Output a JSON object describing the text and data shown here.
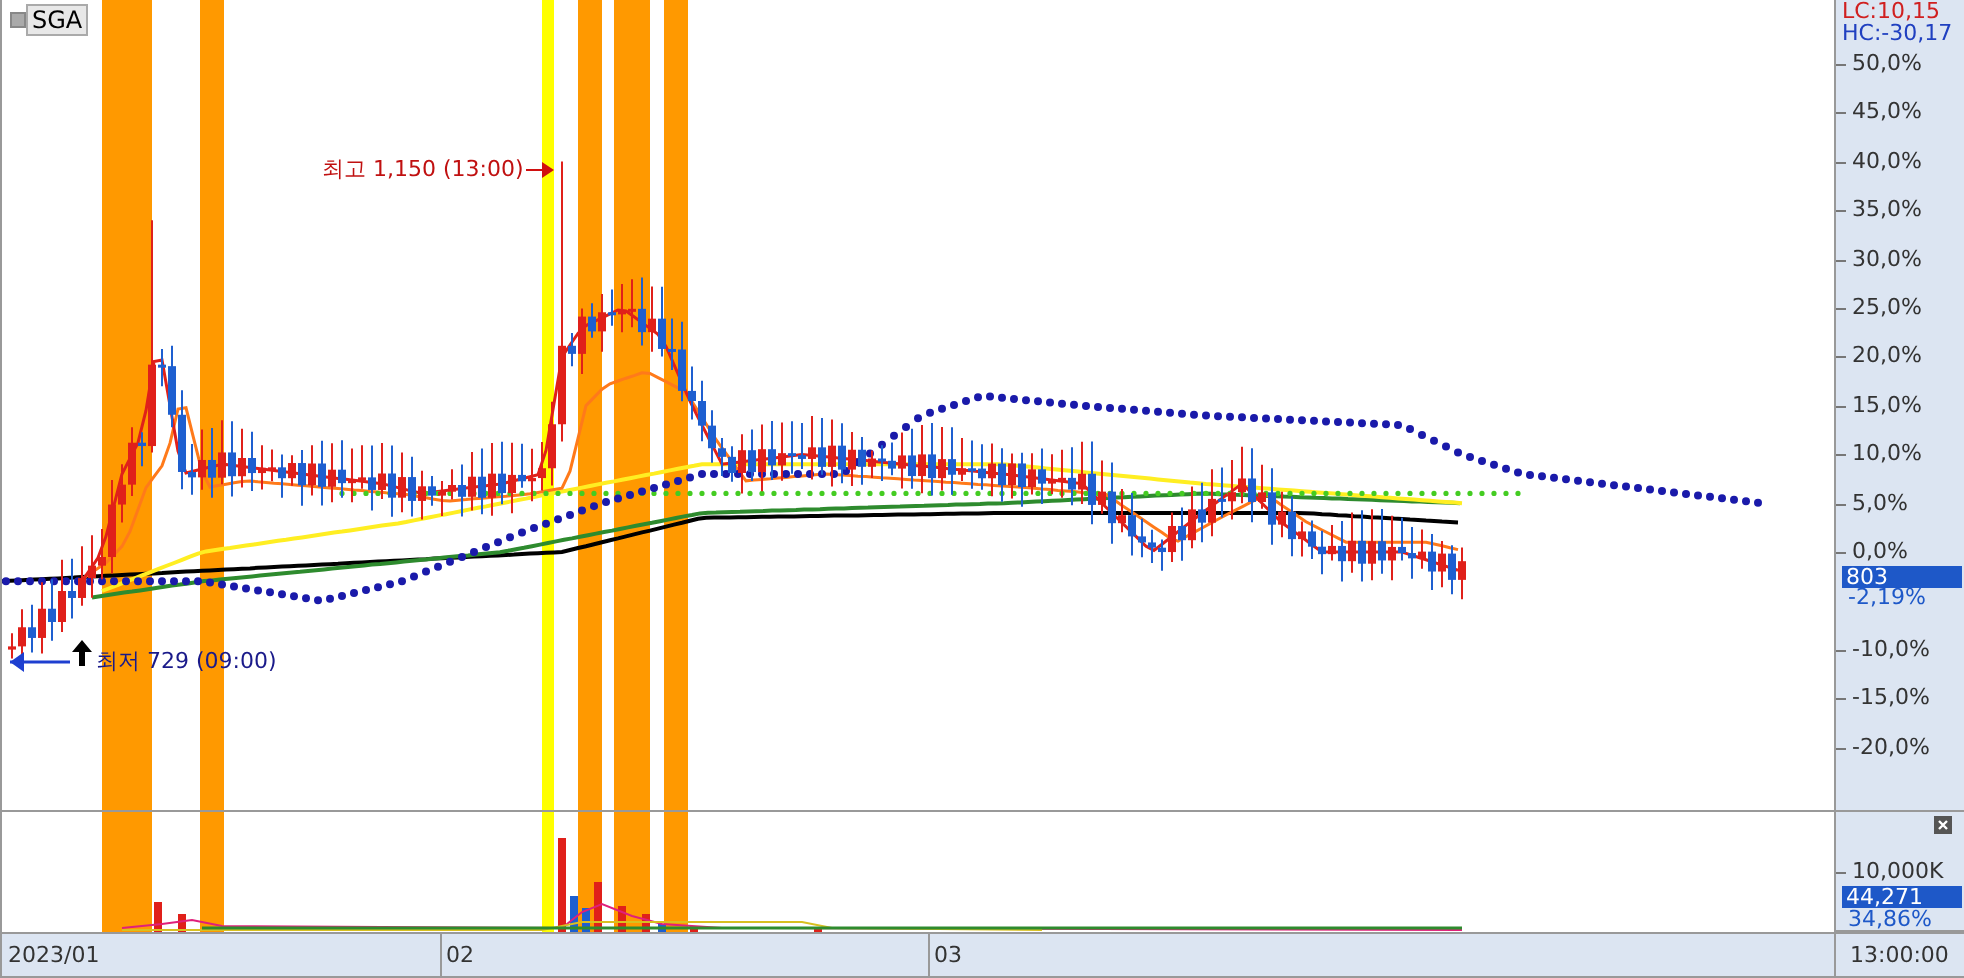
{
  "symbol": "SGA",
  "annotations": [
    {
      "kind": "high",
      "text": "최고 1,150 (13:00)"
    },
    {
      "kind": "low",
      "text": "최저 729 (09:00)"
    }
  ],
  "axis": {
    "lc": "LC:10,15",
    "hc": "HC:-30,17",
    "ticks_upper": [
      "50,0%",
      "45,0%",
      "40,0%",
      "35,0%",
      "30,0%",
      "25,0%",
      "20,0%",
      "15,0%",
      "10,0%",
      "5,0%",
      "0,0%"
    ],
    "price_badge": "803",
    "price_change": "-2,19%",
    "ticks_lower": [
      "-10,0%",
      "-15,0%",
      "-20,0%"
    ]
  },
  "volume": {
    "tick": "10,000K",
    "badge": "44,271",
    "change": "34,86%"
  },
  "dates": [
    "2023/01",
    "02",
    "03"
  ],
  "time": "13:00:00"
}
